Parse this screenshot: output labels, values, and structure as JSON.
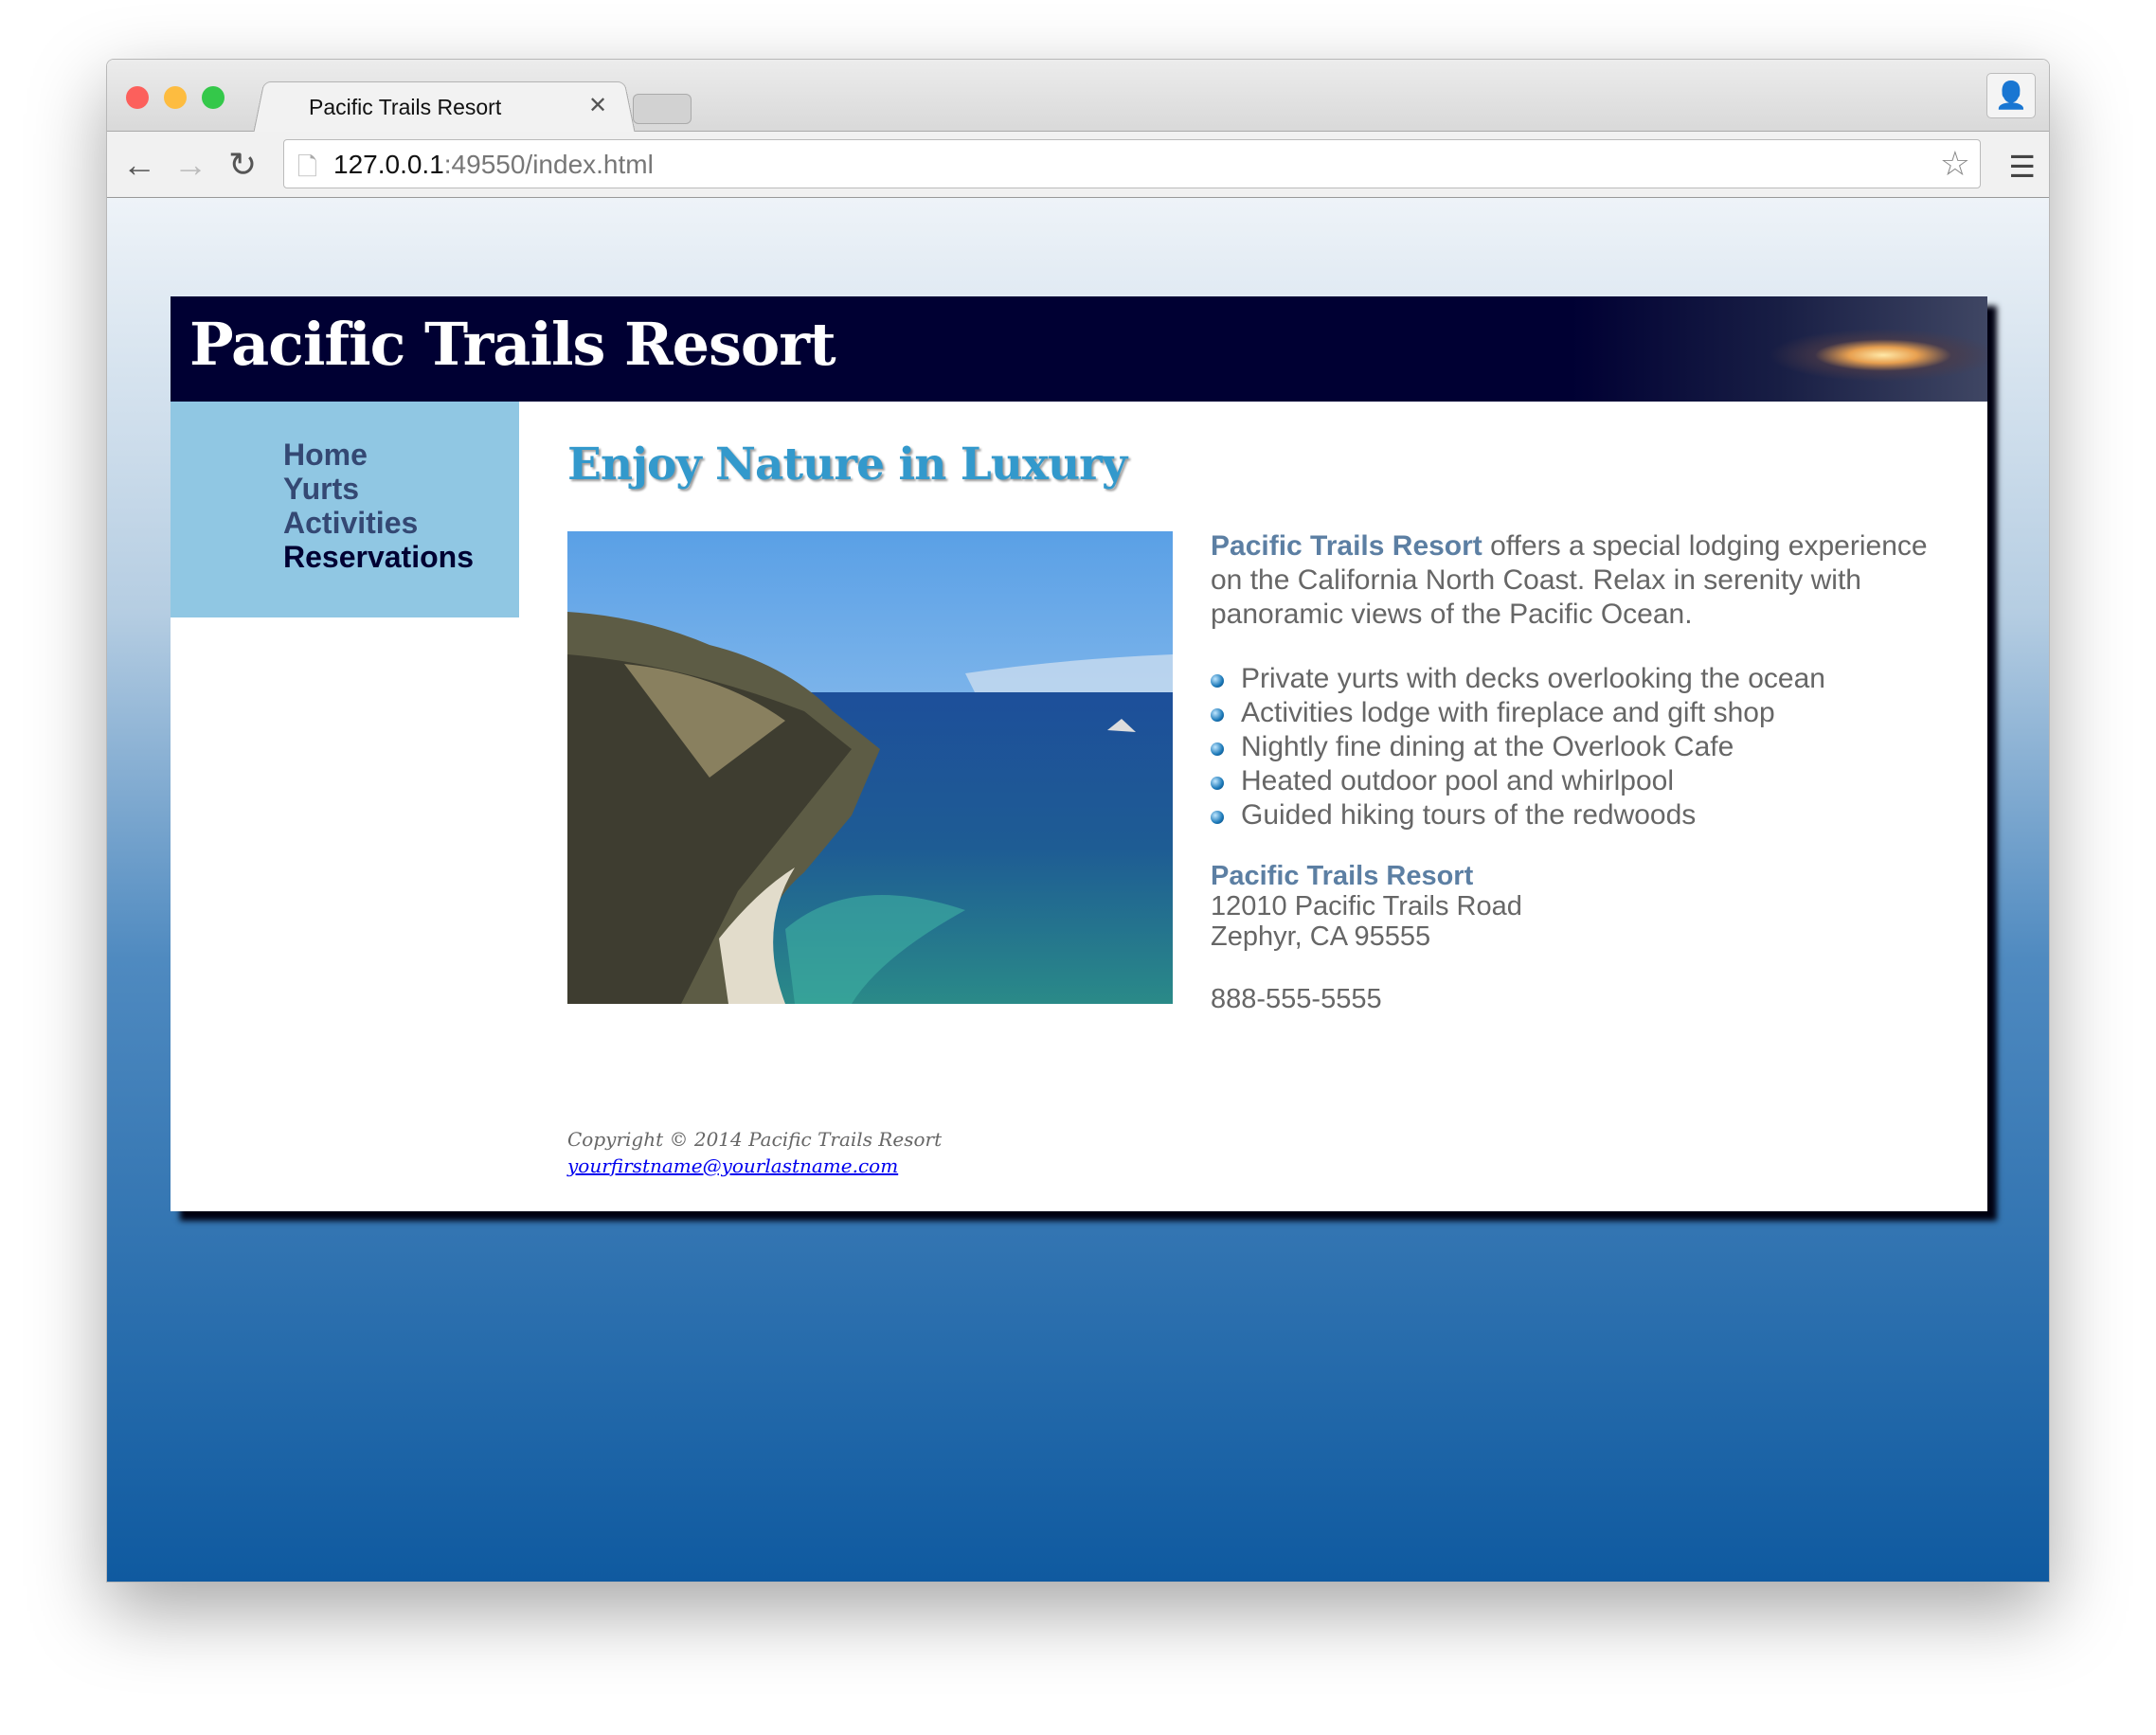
{
  "browser": {
    "tab_title": "Pacific Trails Resort",
    "url_host": "127.0.0.1",
    "url_rest": ":49550/index.html"
  },
  "site": {
    "title": "Pacific Trails Resort",
    "nav": [
      {
        "label": "Home"
      },
      {
        "label": "Yurts"
      },
      {
        "label": "Activities"
      },
      {
        "label": "Reservations"
      }
    ],
    "heading": "Enjoy Nature in Luxury",
    "intro_name": "Pacific Trails Resort",
    "intro_rest": " offers a special lodging experience on the California North Coast. Relax in serenity with panoramic views of the Pacific Ocean.",
    "features": [
      "Private yurts with decks overlooking the ocean",
      "Activities lodge with fireplace and gift shop",
      "Nightly fine dining at the Overlook Cafe",
      "Heated outdoor pool and whirlpool",
      "Guided hiking tours of the redwoods"
    ],
    "address": {
      "name": "Pacific Trails Resort",
      "street": "12010 Pacific Trails Road",
      "city": "Zephyr, CA 95555",
      "phone": "888-555-5555"
    },
    "footer": {
      "copyright": "Copyright © 2014 Pacific Trails Resort",
      "email": "yourfirstname@yourlastname.com"
    }
  },
  "colors": {
    "header": "#000033",
    "nav": "#90c7e3",
    "heading": "#3399cc"
  }
}
